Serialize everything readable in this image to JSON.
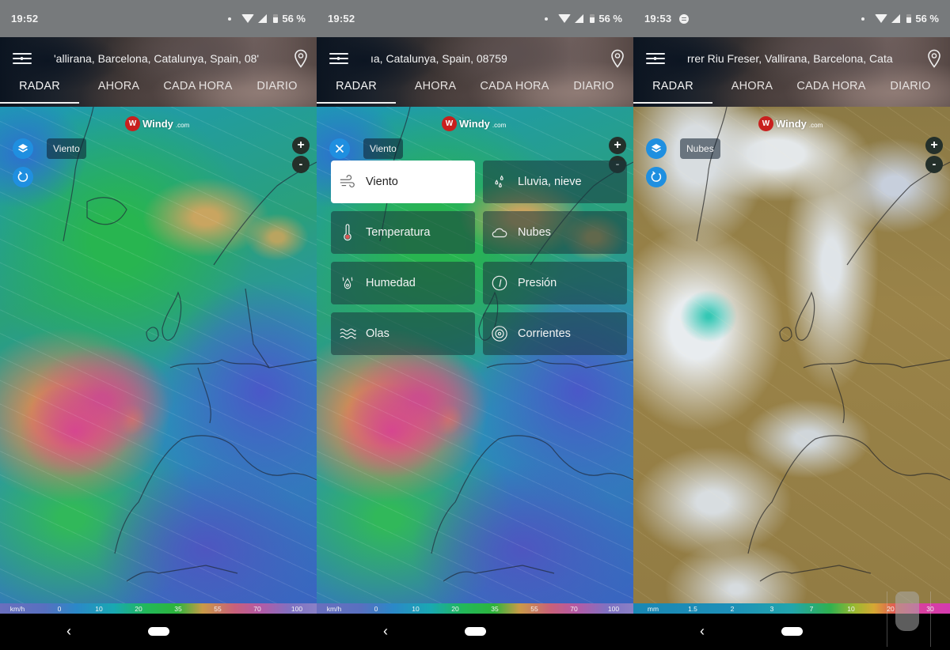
{
  "screens": [
    {
      "status": {
        "time": "19:52",
        "spotify": false,
        "battery": "56 %"
      },
      "header": {
        "location": "'allirana, Barcelona, Catalunya, Spain, 08'",
        "tabs": [
          {
            "label": "RADAR",
            "active": true
          },
          {
            "label": "AHORA",
            "active": false
          },
          {
            "label": "CADA HORA",
            "active": false
          },
          {
            "label": "DIARIO",
            "active": false
          }
        ]
      },
      "map": {
        "logo": {
          "mark": "W",
          "word": "Windy",
          "domain": ".com"
        },
        "overlay_label": "Viento",
        "left_button": "layers-icon",
        "reload": true,
        "zoom_in": "+",
        "zoom_out": "-"
      },
      "legend": {
        "unit": "km/h",
        "ticks": [
          "0",
          "10",
          "20",
          "35",
          "55",
          "70",
          "100"
        ]
      }
    },
    {
      "status": {
        "time": "19:52",
        "spotify": false,
        "battery": "56 %"
      },
      "header": {
        "location": "ıa, Catalunya, Spain, 08759",
        "tabs": [
          {
            "label": "RADAR",
            "active": true
          },
          {
            "label": "AHORA",
            "active": false
          },
          {
            "label": "CADA HORA",
            "active": false
          },
          {
            "label": "DIARIO",
            "active": false
          }
        ]
      },
      "map": {
        "logo": {
          "mark": "W",
          "word": "Windy",
          "domain": ".com"
        },
        "overlay_label": "Viento",
        "left_button": "close-icon",
        "reload": false,
        "zoom_in": "+",
        "zoom_out": "-",
        "picker": [
          {
            "label": "Viento",
            "icon": "wind-icon",
            "selected": true
          },
          {
            "label": "Lluvia, nieve",
            "icon": "rain-snow-icon",
            "selected": false
          },
          {
            "label": "Temperatura",
            "icon": "thermometer-icon",
            "selected": false
          },
          {
            "label": "Nubes",
            "icon": "cloud-icon",
            "selected": false
          },
          {
            "label": "Humedad",
            "icon": "humidity-icon",
            "selected": false
          },
          {
            "label": "Presión",
            "icon": "pressure-gauge-icon",
            "selected": false
          },
          {
            "label": "Olas",
            "icon": "waves-icon",
            "selected": false
          },
          {
            "label": "Corrientes",
            "icon": "currents-icon",
            "selected": false
          }
        ]
      },
      "legend": {
        "unit": "km/h",
        "ticks": [
          "0",
          "10",
          "20",
          "35",
          "55",
          "70",
          "100"
        ]
      }
    },
    {
      "status": {
        "time": "19:53",
        "spotify": true,
        "battery": "56 %"
      },
      "header": {
        "location": "rrer Riu Freser, Vallirana, Barcelona, Cata",
        "tabs": [
          {
            "label": "RADAR",
            "active": true
          },
          {
            "label": "AHORA",
            "active": false
          },
          {
            "label": "CADA HORA",
            "active": false
          },
          {
            "label": "DIARIO",
            "active": false
          }
        ]
      },
      "map": {
        "logo": {
          "mark": "W",
          "word": "Windy",
          "domain": ".com"
        },
        "overlay_label": "Nubes",
        "left_button": "layers-icon",
        "reload": true,
        "zoom_in": "+",
        "zoom_out": "-"
      },
      "legend": {
        "unit": "mm",
        "ticks": [
          "1.5",
          "2",
          "3",
          "7",
          "10",
          "20",
          "30"
        ]
      }
    }
  ],
  "colors": {
    "accent_blue": "#1f8fe0",
    "windy_red": "#c8201e",
    "status_bar": "#777a7c"
  }
}
